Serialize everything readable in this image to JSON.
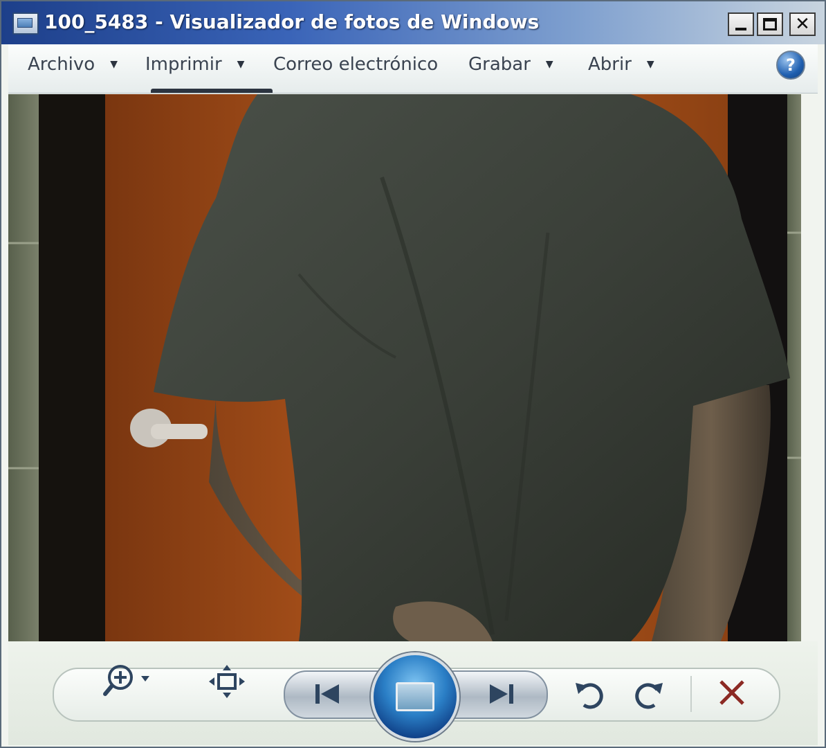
{
  "window": {
    "title": "100_5483 - Visualizador de fotos de Windows"
  },
  "titlebar_buttons": {
    "minimize_icon": "minimize-icon",
    "maximize_icon": "maximize-icon",
    "close_glyph": "✕"
  },
  "menu": {
    "items": [
      {
        "label": "Archivo",
        "has_dropdown": true
      },
      {
        "label": "Imprimir",
        "has_dropdown": true
      },
      {
        "label": "Correo electrónico",
        "has_dropdown": false
      },
      {
        "label": "Grabar",
        "has_dropdown": true
      },
      {
        "label": "Abrir",
        "has_dropdown": true
      }
    ],
    "caret": "▼",
    "help_glyph": "?"
  },
  "toolbar": {
    "zoom_icon": "zoom-icon",
    "fit_icon": "actual-size-icon",
    "previous_icon": "previous-icon",
    "slideshow_icon": "slideshow-icon",
    "next_icon": "next-icon",
    "rotate_left_icon": "rotate-counterclockwise-icon",
    "rotate_right_icon": "rotate-clockwise-icon",
    "delete_glyph": "✕"
  },
  "colors": {
    "title_gradient_start": "#1d3f8a",
    "delete_red": "#8c2a24",
    "control_blue": "#2e4560"
  }
}
